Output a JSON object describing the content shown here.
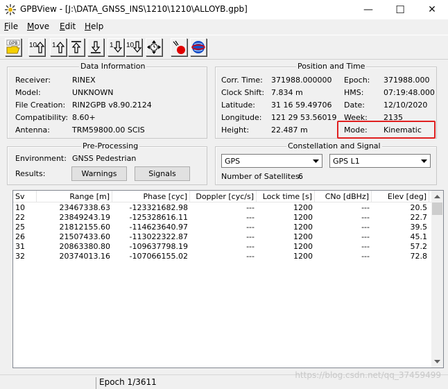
{
  "window": {
    "title": "GPBView - [J:\\DATA_GNSS_INS\\1210\\1210\\ALLOYB.gpb]",
    "minimize": "—",
    "maximize": "☐",
    "close": "✕"
  },
  "menu": {
    "file": {
      "first": "F",
      "rest": "ile"
    },
    "move": {
      "first": "M",
      "rest": "ove"
    },
    "edit": {
      "first": "E",
      "rest": "dit"
    },
    "help": {
      "first": "H",
      "rest": "elp"
    }
  },
  "toolbar": {
    "open_label": "GPB",
    "items": [
      {
        "name": "open-gpb-button",
        "icon": "folder-open-icon"
      },
      {
        "name": "back-10-epochs-button",
        "icon": "up-10-arrow-icon",
        "num": "10"
      },
      {
        "name": "back-1-epoch-button",
        "icon": "up-1-arrow-icon",
        "num": "1"
      },
      {
        "name": "first-epoch-button",
        "icon": "top-arrow-icon"
      },
      {
        "name": "last-epoch-button",
        "icon": "bottom-arrow-icon"
      },
      {
        "name": "forward-1-epoch-button",
        "icon": "down-1-arrow-icon",
        "num": "1"
      },
      {
        "name": "forward-10-epochs-button",
        "icon": "down-10-arrow-icon",
        "num": "10"
      },
      {
        "name": "goto-time-button",
        "icon": "clock-arrows-icon"
      },
      {
        "name": "stop-button",
        "icon": "stop-marker-icon"
      },
      {
        "name": "about-button",
        "icon": "globe-icon"
      }
    ]
  },
  "data_info": {
    "title": "Data Information",
    "rows": [
      {
        "label": "Receiver:",
        "value": "RINEX"
      },
      {
        "label": "Model:",
        "value": "UNKNOWN"
      },
      {
        "label": "File Creation:",
        "value": "RIN2GPB v8.90.2124"
      },
      {
        "label": "Compatibility:",
        "value": "8.60+"
      },
      {
        "label": "Antenna:",
        "value": "TRM59800.00 SCIS"
      }
    ]
  },
  "position_time": {
    "title": "Position and Time",
    "left": [
      {
        "label": "Corr. Time:",
        "value": "371988.000000"
      },
      {
        "label": "Clock Shift:",
        "value": "7.834 m"
      },
      {
        "label": "Latitude:",
        "value": "31 16 59.49706"
      },
      {
        "label": "Longitude:",
        "value": "121 29 53.56019"
      },
      {
        "label": "Height:",
        "value": "22.487 m"
      }
    ],
    "right": [
      {
        "label": "Epoch:",
        "value": "371988.000"
      },
      {
        "label": "HMS:",
        "value": "07:19:48.000"
      },
      {
        "label": "Date:",
        "value": "12/10/2020"
      },
      {
        "label": "Week:",
        "value": "2135"
      },
      {
        "label": "Mode:",
        "value": "Kinematic"
      }
    ]
  },
  "preprocessing": {
    "title": "Pre-Processing",
    "environment_label": "Environment:",
    "environment_value": "GNSS Pedestrian",
    "results_label": "Results:",
    "warnings_button": "Warnings",
    "signals_button": "Signals"
  },
  "constellation": {
    "title": "Constellation and Signal",
    "constellation_selected": "GPS",
    "signal_selected": "GPS L1",
    "num_sats_label": "Number of Satellites:",
    "num_sats_value": "6"
  },
  "table": {
    "columns": [
      "Sv",
      "Range [m]",
      "Phase [cyc]",
      "Doppler [cyc/s]",
      "Lock time [s]",
      "CNo [dBHz]",
      "Elev [deg]"
    ],
    "rows": [
      [
        "10",
        "23467338.63",
        "-123321682.98",
        "---",
        "1200",
        "---",
        "20.5"
      ],
      [
        "22",
        "23849243.19",
        "-125328616.11",
        "---",
        "1200",
        "---",
        "22.7"
      ],
      [
        "25",
        "21812155.60",
        "-114623640.97",
        "---",
        "1200",
        "---",
        "39.5"
      ],
      [
        "26",
        "21507433.60",
        "-113022322.87",
        "---",
        "1200",
        "---",
        "45.1"
      ],
      [
        "31",
        "20863380.80",
        "-109637798.19",
        "---",
        "1200",
        "---",
        "57.2"
      ],
      [
        "32",
        "20374013.16",
        "-107066155.02",
        "---",
        "1200",
        "---",
        "72.8"
      ]
    ]
  },
  "status": {
    "epoch": "Epoch 1/3611"
  },
  "watermark": "https://blog.csdn.net/qq_37459499",
  "colors": {
    "highlight": "#e02020",
    "window_bg": "#f0f0f0"
  }
}
